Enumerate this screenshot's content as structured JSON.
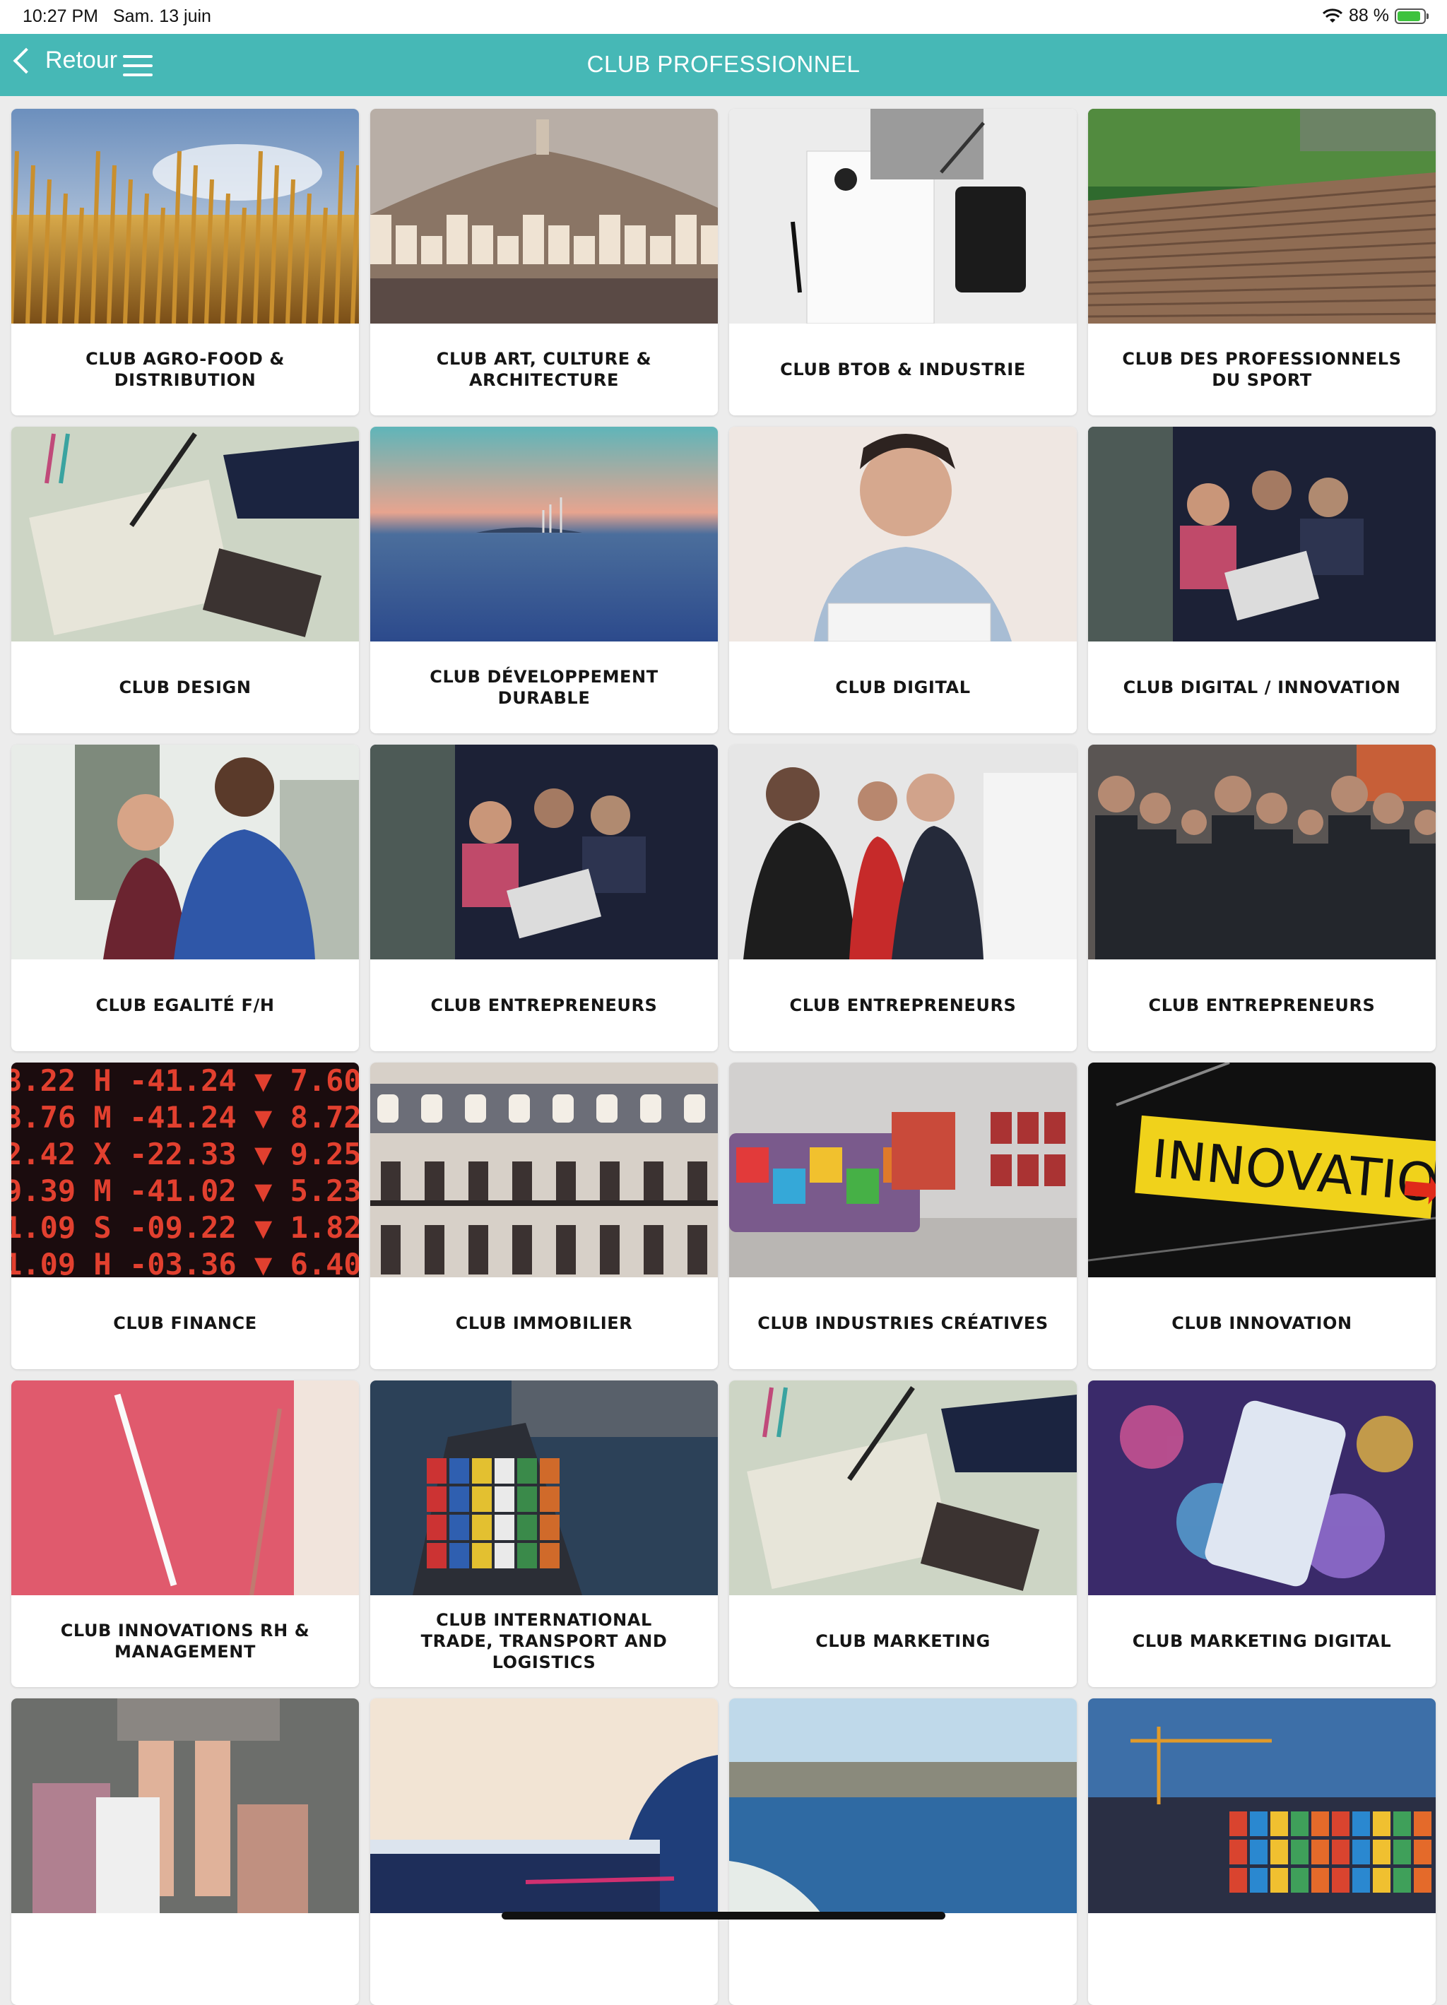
{
  "status": {
    "time": "10:27 PM",
    "date": "Sam. 13 juin",
    "battery": "88 %",
    "battery_level": 0.88
  },
  "nav": {
    "back_label": "Retour",
    "title": "CLUB PROFESSIONNEL"
  },
  "clubs": [
    {
      "label": "CLUB AGRO-FOOD & DISTRIBUTION",
      "icon": "wheat-field-photo"
    },
    {
      "label": "CLUB ART, CULTURE & ARCHITECTURE",
      "icon": "city-hill-photo"
    },
    {
      "label": "CLUB BTOB & INDUSTRIE",
      "icon": "desk-tablet-photo"
    },
    {
      "label": "CLUB DES PROFESSIONNELS DU SPORT",
      "icon": "stadium-photo"
    },
    {
      "label": "CLUB DESIGN",
      "icon": "drawing-tablet-photo"
    },
    {
      "label": "CLUB DÉVELOPPEMENT DURABLE",
      "icon": "wind-turbines-sea-photo"
    },
    {
      "label": "CLUB DIGITAL",
      "icon": "man-laptop-photo"
    },
    {
      "label": "CLUB DIGITAL / INNOVATION",
      "icon": "team-laptop-photo"
    },
    {
      "label": "CLUB EGALITÉ F/H",
      "icon": "woman-man-photo"
    },
    {
      "label": "CLUB ENTREPRENEURS",
      "icon": "team-laptop-photo"
    },
    {
      "label": "CLUB ENTREPRENEURS",
      "icon": "networking-event-photo"
    },
    {
      "label": "CLUB ENTREPRENEURS",
      "icon": "crowd-event-photo"
    },
    {
      "label": "CLUB FINANCE",
      "icon": "stock-ticker-photo"
    },
    {
      "label": "CLUB IMMOBILIER",
      "icon": "building-facade-photo"
    },
    {
      "label": "CLUB INDUSTRIES CRÉATIVES",
      "icon": "graffiti-gallery-photo"
    },
    {
      "label": "CLUB INNOVATION",
      "icon": "innovation-sign-photo",
      "sign_text": "INNOVATION"
    },
    {
      "label": "CLUB INNOVATIONS RH & MANAGEMENT",
      "icon": "pen-notebook-photo"
    },
    {
      "label": "CLUB INTERNATIONAL TRADE, TRANSPORT AND LOGISTICS",
      "icon": "cargo-ship-photo"
    },
    {
      "label": "CLUB MARKETING",
      "icon": "drawing-tablet-photo"
    },
    {
      "label": "CLUB MARKETING DIGITAL",
      "icon": "phone-bokeh-photo"
    },
    {
      "label": "",
      "icon": "shopping-bags-photo"
    },
    {
      "label": "",
      "icon": "desk-blue-photo"
    },
    {
      "label": "",
      "icon": "harbor-sea-photo"
    },
    {
      "label": "",
      "icon": "port-night-photo"
    }
  ],
  "colors": {
    "accent": "#46b8b6",
    "card_bg": "#ffffff",
    "page_bg": "#ececec"
  }
}
